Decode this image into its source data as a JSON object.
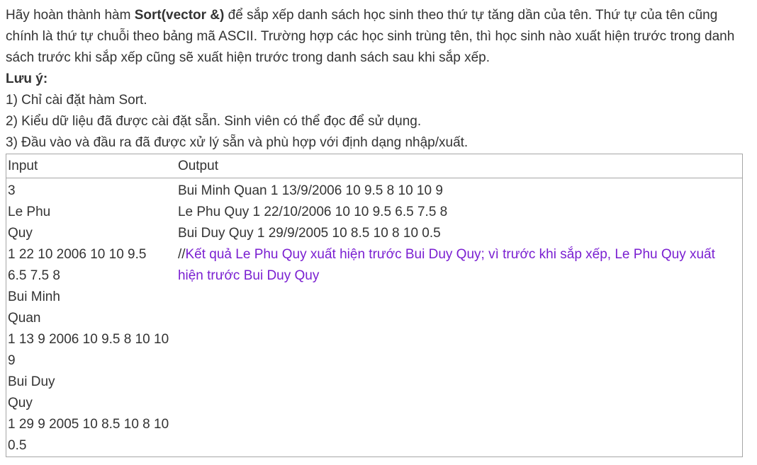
{
  "intro": {
    "p1_before": "Hãy hoàn thành hàm ",
    "p1_bold": "Sort(vector &)",
    "p1_after": " để sắp xếp danh sách học sinh theo thứ tự tăng dần của tên. Thứ tự của tên cũng chính là thứ tự chuỗi theo bảng mã ASCII. Trường hợp các học sinh trùng tên, thì học sinh nào xuất hiện trước trong danh sách trước khi sắp xếp cũng sẽ xuất hiện trước trong danh sách sau khi sắp xếp.",
    "note_heading": "Lưu ý:",
    "notes": [
      "1) Chỉ cài đặt hàm Sort.",
      "2) Kiểu dữ liệu đã được cài đặt sẵn. Sinh viên có thể đọc để sử dụng.",
      "3) Đầu vào và đầu ra đã được xử lý sẵn và phù hợp với định dạng nhập/xuất."
    ]
  },
  "table": {
    "headers": [
      "Input",
      "Output"
    ],
    "input_lines": [
      "3",
      "Le Phu",
      "Quy",
      "1 22 10 2006 10 10 9.5",
      "6.5 7.5 8",
      "Bui Minh",
      "Quan",
      "1 13 9 2006 10 9.5 8 10 10",
      "9",
      "Bui Duy",
      "Quy",
      "1 29 9 2005 10 8.5 10 8 10",
      "0.5"
    ],
    "output_lines": [
      "Bui Minh Quan 1 13/9/2006 10 9.5 8 10 10 9",
      "Le Phu Quy 1 22/10/2006 10 10 9.5 6.5 7.5 8",
      "Bui Duy Quy 1 29/9/2005 10 8.5 10 8 10 0.5"
    ],
    "comment_prefix": "//",
    "comment_text": "Kết quả Le Phu Quy xuất hiện trước Bui Duy Quy; vì trước khi sắp xếp, Le Phu Quy xuất hiện trước Bui Duy Quy"
  },
  "colors": {
    "text": "#333333",
    "comment": "#7a1fd1",
    "border": "#a6a6a6"
  }
}
